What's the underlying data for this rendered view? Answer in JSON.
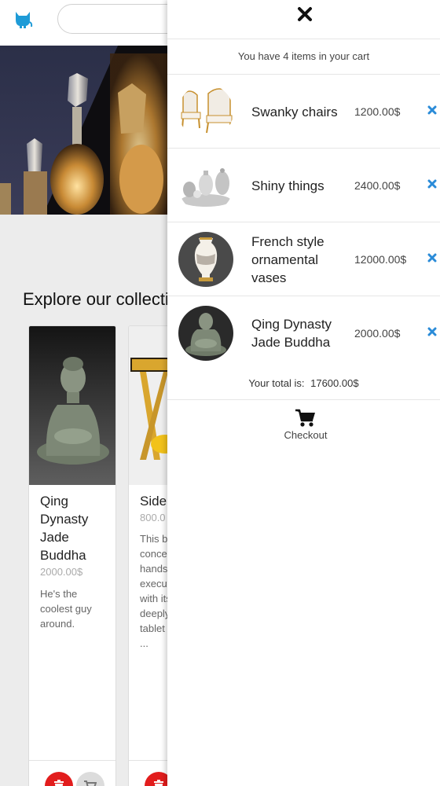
{
  "header": {
    "logo_icon": "cat-logo-icon",
    "accent_color": "#1e9bd7"
  },
  "search": {
    "value": "",
    "placeholder": ""
  },
  "collection": {
    "title": "Explore our collection",
    "products": [
      {
        "name": "Qing Dynasty Jade Buddha",
        "price": "2000.00$",
        "description": "He's the coolest guy around."
      },
      {
        "name": "Side",
        "price": "800.0",
        "description": "This brilliant concept and handsome executed chair with its broad, deeply curved tablet the arm ..."
      }
    ]
  },
  "cart": {
    "count_text": "You have 4 items in your cart",
    "items": [
      {
        "name": "Swanky chairs",
        "price": "1200.00$"
      },
      {
        "name": "Shiny things",
        "price": "2400.00$"
      },
      {
        "name": "French style ornamental vases",
        "price": "12000.00$"
      },
      {
        "name": "Qing Dynasty Jade Buddha",
        "price": "2000.00$"
      }
    ],
    "total_label": "Your total is:",
    "total_value": "17600.00$",
    "checkout_label": "Checkout",
    "remove_color": "#2a8bd8"
  }
}
